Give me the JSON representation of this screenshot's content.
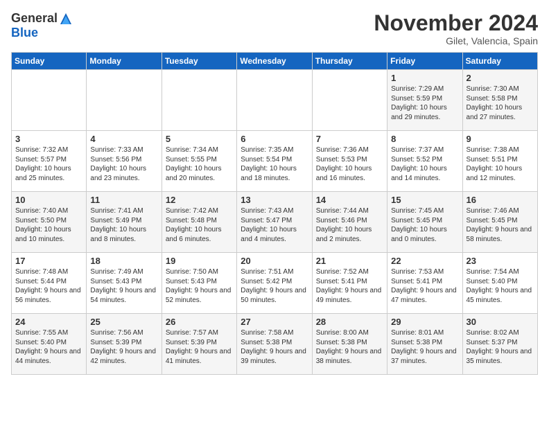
{
  "header": {
    "logo_general": "General",
    "logo_blue": "Blue",
    "month_title": "November 2024",
    "location": "Gilet, Valencia, Spain"
  },
  "weekdays": [
    "Sunday",
    "Monday",
    "Tuesday",
    "Wednesday",
    "Thursday",
    "Friday",
    "Saturday"
  ],
  "weeks": [
    [
      {
        "day": "",
        "content": ""
      },
      {
        "day": "",
        "content": ""
      },
      {
        "day": "",
        "content": ""
      },
      {
        "day": "",
        "content": ""
      },
      {
        "day": "",
        "content": ""
      },
      {
        "day": "1",
        "content": "Sunrise: 7:29 AM\nSunset: 5:59 PM\nDaylight: 10 hours and 29 minutes."
      },
      {
        "day": "2",
        "content": "Sunrise: 7:30 AM\nSunset: 5:58 PM\nDaylight: 10 hours and 27 minutes."
      }
    ],
    [
      {
        "day": "3",
        "content": "Sunrise: 7:32 AM\nSunset: 5:57 PM\nDaylight: 10 hours and 25 minutes."
      },
      {
        "day": "4",
        "content": "Sunrise: 7:33 AM\nSunset: 5:56 PM\nDaylight: 10 hours and 23 minutes."
      },
      {
        "day": "5",
        "content": "Sunrise: 7:34 AM\nSunset: 5:55 PM\nDaylight: 10 hours and 20 minutes."
      },
      {
        "day": "6",
        "content": "Sunrise: 7:35 AM\nSunset: 5:54 PM\nDaylight: 10 hours and 18 minutes."
      },
      {
        "day": "7",
        "content": "Sunrise: 7:36 AM\nSunset: 5:53 PM\nDaylight: 10 hours and 16 minutes."
      },
      {
        "day": "8",
        "content": "Sunrise: 7:37 AM\nSunset: 5:52 PM\nDaylight: 10 hours and 14 minutes."
      },
      {
        "day": "9",
        "content": "Sunrise: 7:38 AM\nSunset: 5:51 PM\nDaylight: 10 hours and 12 minutes."
      }
    ],
    [
      {
        "day": "10",
        "content": "Sunrise: 7:40 AM\nSunset: 5:50 PM\nDaylight: 10 hours and 10 minutes."
      },
      {
        "day": "11",
        "content": "Sunrise: 7:41 AM\nSunset: 5:49 PM\nDaylight: 10 hours and 8 minutes."
      },
      {
        "day": "12",
        "content": "Sunrise: 7:42 AM\nSunset: 5:48 PM\nDaylight: 10 hours and 6 minutes."
      },
      {
        "day": "13",
        "content": "Sunrise: 7:43 AM\nSunset: 5:47 PM\nDaylight: 10 hours and 4 minutes."
      },
      {
        "day": "14",
        "content": "Sunrise: 7:44 AM\nSunset: 5:46 PM\nDaylight: 10 hours and 2 minutes."
      },
      {
        "day": "15",
        "content": "Sunrise: 7:45 AM\nSunset: 5:45 PM\nDaylight: 10 hours and 0 minutes."
      },
      {
        "day": "16",
        "content": "Sunrise: 7:46 AM\nSunset: 5:45 PM\nDaylight: 9 hours and 58 minutes."
      }
    ],
    [
      {
        "day": "17",
        "content": "Sunrise: 7:48 AM\nSunset: 5:44 PM\nDaylight: 9 hours and 56 minutes."
      },
      {
        "day": "18",
        "content": "Sunrise: 7:49 AM\nSunset: 5:43 PM\nDaylight: 9 hours and 54 minutes."
      },
      {
        "day": "19",
        "content": "Sunrise: 7:50 AM\nSunset: 5:43 PM\nDaylight: 9 hours and 52 minutes."
      },
      {
        "day": "20",
        "content": "Sunrise: 7:51 AM\nSunset: 5:42 PM\nDaylight: 9 hours and 50 minutes."
      },
      {
        "day": "21",
        "content": "Sunrise: 7:52 AM\nSunset: 5:41 PM\nDaylight: 9 hours and 49 minutes."
      },
      {
        "day": "22",
        "content": "Sunrise: 7:53 AM\nSunset: 5:41 PM\nDaylight: 9 hours and 47 minutes."
      },
      {
        "day": "23",
        "content": "Sunrise: 7:54 AM\nSunset: 5:40 PM\nDaylight: 9 hours and 45 minutes."
      }
    ],
    [
      {
        "day": "24",
        "content": "Sunrise: 7:55 AM\nSunset: 5:40 PM\nDaylight: 9 hours and 44 minutes."
      },
      {
        "day": "25",
        "content": "Sunrise: 7:56 AM\nSunset: 5:39 PM\nDaylight: 9 hours and 42 minutes."
      },
      {
        "day": "26",
        "content": "Sunrise: 7:57 AM\nSunset: 5:39 PM\nDaylight: 9 hours and 41 minutes."
      },
      {
        "day": "27",
        "content": "Sunrise: 7:58 AM\nSunset: 5:38 PM\nDaylight: 9 hours and 39 minutes."
      },
      {
        "day": "28",
        "content": "Sunrise: 8:00 AM\nSunset: 5:38 PM\nDaylight: 9 hours and 38 minutes."
      },
      {
        "day": "29",
        "content": "Sunrise: 8:01 AM\nSunset: 5:38 PM\nDaylight: 9 hours and 37 minutes."
      },
      {
        "day": "30",
        "content": "Sunrise: 8:02 AM\nSunset: 5:37 PM\nDaylight: 9 hours and 35 minutes."
      }
    ]
  ]
}
